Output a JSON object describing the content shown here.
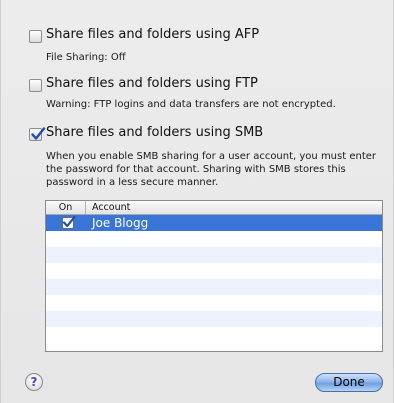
{
  "options": [
    {
      "label": "Share files and folders using AFP",
      "checked": false,
      "description": [
        "File Sharing: Off"
      ]
    },
    {
      "label": "Share files and folders using FTP",
      "checked": false,
      "description": [
        "Warning: FTP logins and data transfers are not encrypted."
      ]
    },
    {
      "label": "Share files and folders using SMB",
      "checked": true,
      "description": [
        "When you enable SMB sharing for a user account, you must enter",
        "the password for that account. Sharing with SMB stores this",
        "password in a less secure manner."
      ]
    }
  ],
  "accounts_table": {
    "columns": [
      "On",
      "Account"
    ],
    "rows": [
      {
        "on": true,
        "account": "Joe Blogg",
        "selected": true
      }
    ]
  },
  "footer": {
    "help_label": "?",
    "done_label": "Done"
  },
  "colors": {
    "selection": "#3875d7",
    "alt_row": "#edf3fe",
    "checkmark": "#1f4fa8"
  }
}
